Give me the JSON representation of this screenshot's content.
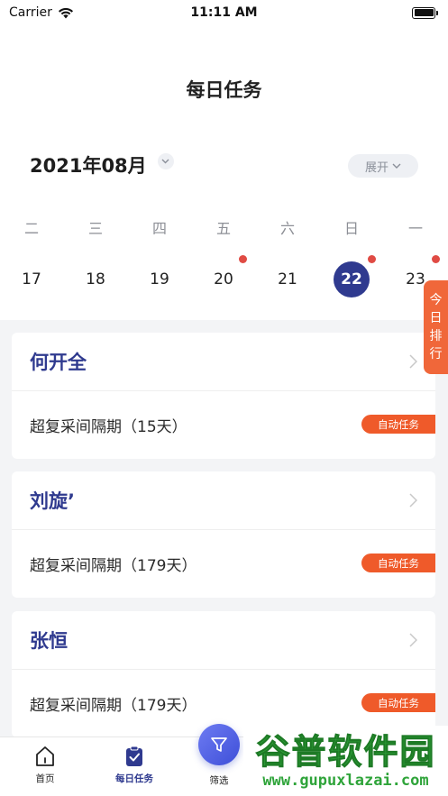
{
  "status_bar": {
    "carrier": "Carrier",
    "time": "11:11 AM"
  },
  "header": {
    "title": "每日任务"
  },
  "calendar": {
    "month": "2021年08月",
    "expand_label": "展开",
    "weekdays": [
      "二",
      "三",
      "四",
      "五",
      "六",
      "日",
      "一"
    ],
    "dates": [
      {
        "day": "17",
        "dot": false,
        "selected": false
      },
      {
        "day": "18",
        "dot": false,
        "selected": false
      },
      {
        "day": "19",
        "dot": false,
        "selected": false
      },
      {
        "day": "20",
        "dot": true,
        "selected": false
      },
      {
        "day": "21",
        "dot": false,
        "selected": false
      },
      {
        "day": "22",
        "dot": true,
        "selected": true
      },
      {
        "day": "23",
        "dot": true,
        "selected": false
      }
    ]
  },
  "side_tab": {
    "chars": [
      "今",
      "日",
      "排",
      "行"
    ]
  },
  "tasks": [
    {
      "name": "何开全",
      "desc": "超复采间隔期（15天）",
      "tag": "自动任务"
    },
    {
      "name": "刘旋’",
      "desc": "超复采间隔期（179天）",
      "tag": "自动任务"
    },
    {
      "name": "张恒",
      "desc": "超复采间隔期（179天）",
      "tag": "自动任务"
    }
  ],
  "tab_bar": {
    "home": "首页",
    "daily": "每日任务",
    "filter": "筛选"
  },
  "watermark": {
    "title": "谷普软件园",
    "url": "www.gupuxlazai.com"
  },
  "colors": {
    "primary": "#2f3a8f",
    "accent": "#ef5a2a",
    "dot": "#e04b44"
  }
}
